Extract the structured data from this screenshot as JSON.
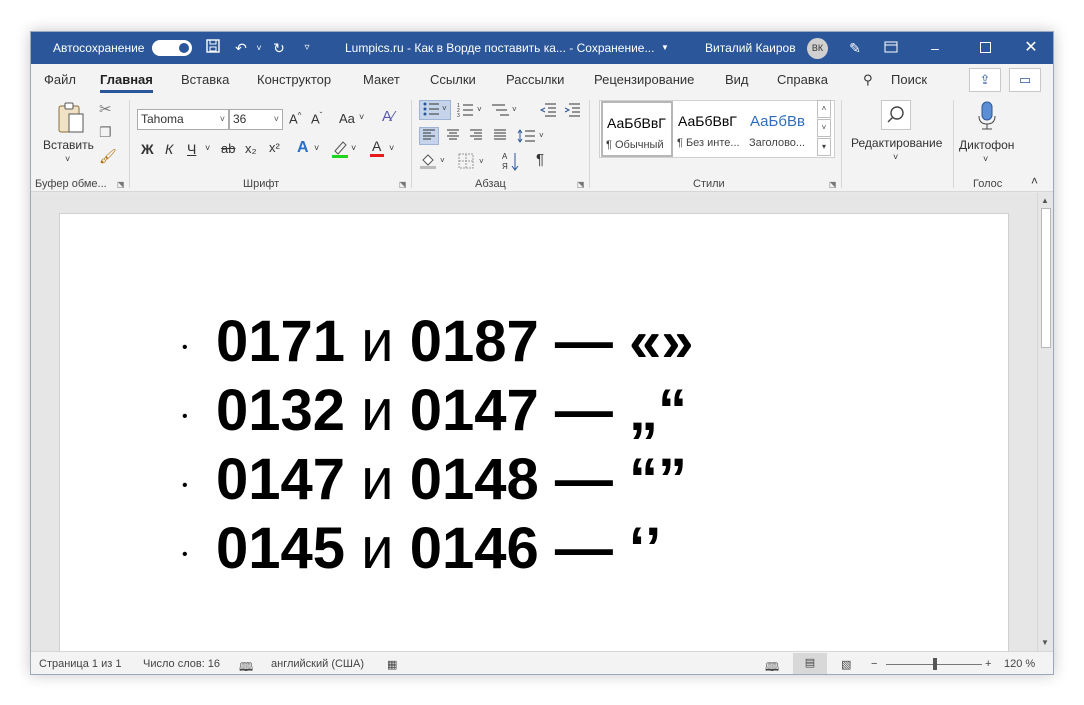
{
  "titlebar": {
    "autosave_label": "Автосохранение",
    "autosave_state": "on",
    "document_title": "Lumpics.ru - Как в Ворде поставить ка...  -  Сохранение...",
    "user_name": "Виталий Каиров",
    "user_initials": "ВК",
    "accent": "#2b579a"
  },
  "tabs": [
    "Файл",
    "Главная",
    "Вставка",
    "Конструктор",
    "Макет",
    "Ссылки",
    "Рассылки",
    "Рецензирование",
    "Вид",
    "Справка"
  ],
  "active_tab": "Главная",
  "search_label": "Поиск",
  "ribbon": {
    "clipboard": {
      "paste_label": "Вставить",
      "group_label": "Буфер обме..."
    },
    "font": {
      "font_name": "Tahoma",
      "font_size": "36",
      "bold": "Ж",
      "italic": "К",
      "underline": "Ч",
      "strike": "ab",
      "subscript": "x₂",
      "superscript": "x²",
      "grow": "A^",
      "shrink": "Aˇ",
      "case": "Aa",
      "group_label": "Шрифт"
    },
    "paragraph": {
      "group_label": "Абзац"
    },
    "styles": {
      "items": [
        {
          "sample": "АаБбВвГ",
          "name": "¶ Обычный"
        },
        {
          "sample": "АаБбВвГ",
          "name": "¶ Без инте..."
        },
        {
          "sample": "АаБбВв",
          "name": "Заголово..."
        }
      ],
      "group_label": "Стили"
    },
    "editing": {
      "label": "Редактирование"
    },
    "voice": {
      "label": "Диктофон",
      "group_label": "Голос"
    }
  },
  "document": {
    "lines": [
      {
        "a": "0171",
        "and": "и",
        "b": "0187",
        "dash": "—",
        "sym": "«»"
      },
      {
        "a": "0132",
        "and": "и",
        "b": "0147",
        "dash": "—",
        "sym": "„“"
      },
      {
        "a": "0147",
        "and": "и",
        "b": "0148",
        "dash": "—",
        "sym": "“”"
      },
      {
        "a": "0145",
        "and": "и",
        "b": "0146",
        "dash": "—",
        "sym": "‘’"
      }
    ]
  },
  "statusbar": {
    "page": "Страница 1 из 1",
    "words": "Число слов: 16",
    "language": "английский (США)",
    "zoom": "120 %",
    "zoom_percent": 120
  }
}
